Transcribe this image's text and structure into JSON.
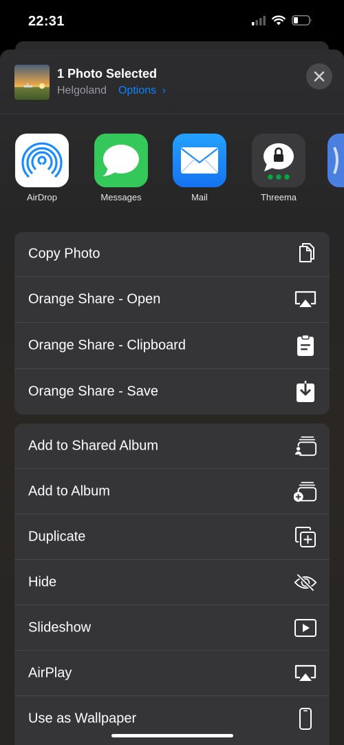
{
  "status_bar": {
    "time": "22:31"
  },
  "header": {
    "title": "1 Photo Selected",
    "location": "Helgoland",
    "options_label": "Options",
    "options_chevron": "›"
  },
  "apps": [
    {
      "label": "AirDrop",
      "icon": "airdrop-icon"
    },
    {
      "label": "Messages",
      "icon": "messages-icon"
    },
    {
      "label": "Mail",
      "icon": "mail-icon"
    },
    {
      "label": "Threema",
      "icon": "threema-icon"
    }
  ],
  "group1": [
    {
      "label": "Copy Photo",
      "icon": "copy-icon"
    },
    {
      "label": "Orange Share - Open",
      "icon": "airplay-icon"
    },
    {
      "label": "Orange Share - Clipboard",
      "icon": "clipboard-icon"
    },
    {
      "label": "Orange Share - Save",
      "icon": "save-icon"
    }
  ],
  "group2": [
    {
      "label": "Add to Shared Album",
      "icon": "shared-album-icon"
    },
    {
      "label": "Add to Album",
      "icon": "add-album-icon"
    },
    {
      "label": "Duplicate",
      "icon": "duplicate-icon"
    },
    {
      "label": "Hide",
      "icon": "hide-icon"
    },
    {
      "label": "Slideshow",
      "icon": "slideshow-icon"
    },
    {
      "label": "AirPlay",
      "icon": "airplay-icon"
    },
    {
      "label": "Use as Wallpaper",
      "icon": "wallpaper-icon"
    }
  ],
  "colors": {
    "accent": "#0a84ff",
    "messages_green": "#34c759",
    "mail_blue": "#1a8cff",
    "threema_green": "#05a63f"
  }
}
